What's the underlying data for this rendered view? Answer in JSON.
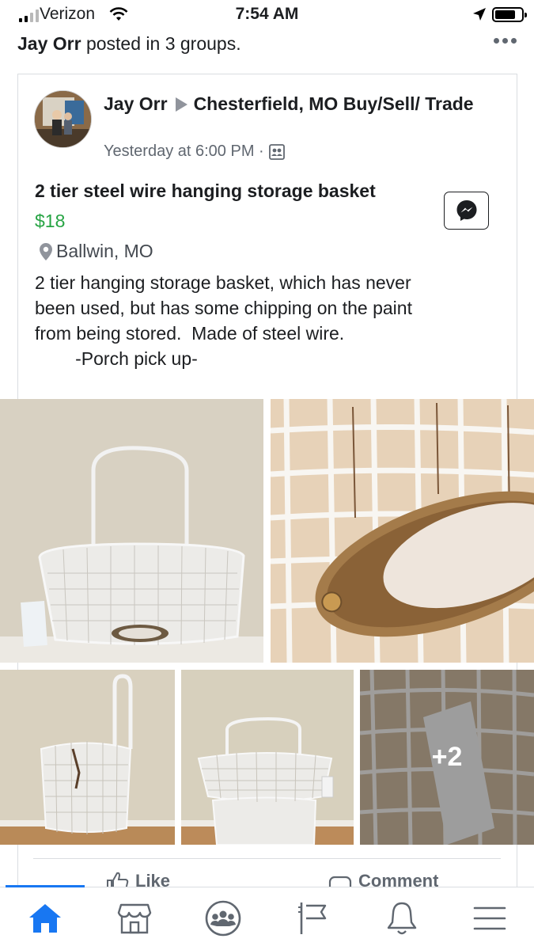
{
  "status_bar": {
    "carrier": "Verizon",
    "time": "7:54 AM",
    "signal_bars_active": 2,
    "signal_bars_total": 4,
    "battery_level": 0.7
  },
  "share_header": {
    "author": "Jay Orr",
    "action": " posted in 3 groups."
  },
  "post": {
    "author": "Jay Orr",
    "group": "Chesterfield, MO Buy/Sell/ Trade",
    "timestamp": "Yesterday at 6:00 PM ·",
    "audience_icon": "group-audience-icon"
  },
  "listing": {
    "title": "2 tier steel wire hanging storage basket",
    "price": "$18",
    "location": "Ballwin, MO",
    "description_lines": [
      "2 tier hanging storage basket, which has never",
      "been used, but has some chipping on the paint",
      "from being stored.  Made of steel wire.",
      "        -Porch pick up-"
    ]
  },
  "photos": {
    "more_count": "+2",
    "count_shown": 5
  },
  "actions": {
    "like": "Like",
    "comment": "Comment"
  },
  "tab_bar": {
    "tabs": [
      "home-icon",
      "marketplace-icon",
      "groups-icon",
      "pages-flag-icon",
      "notifications-bell-icon",
      "menu-icon"
    ],
    "active_tab": "home-icon",
    "active_color": "#1877f2"
  },
  "colors": {
    "price_green": "#27a444",
    "text_secondary": "#606770",
    "accent_blue": "#1877f2"
  }
}
